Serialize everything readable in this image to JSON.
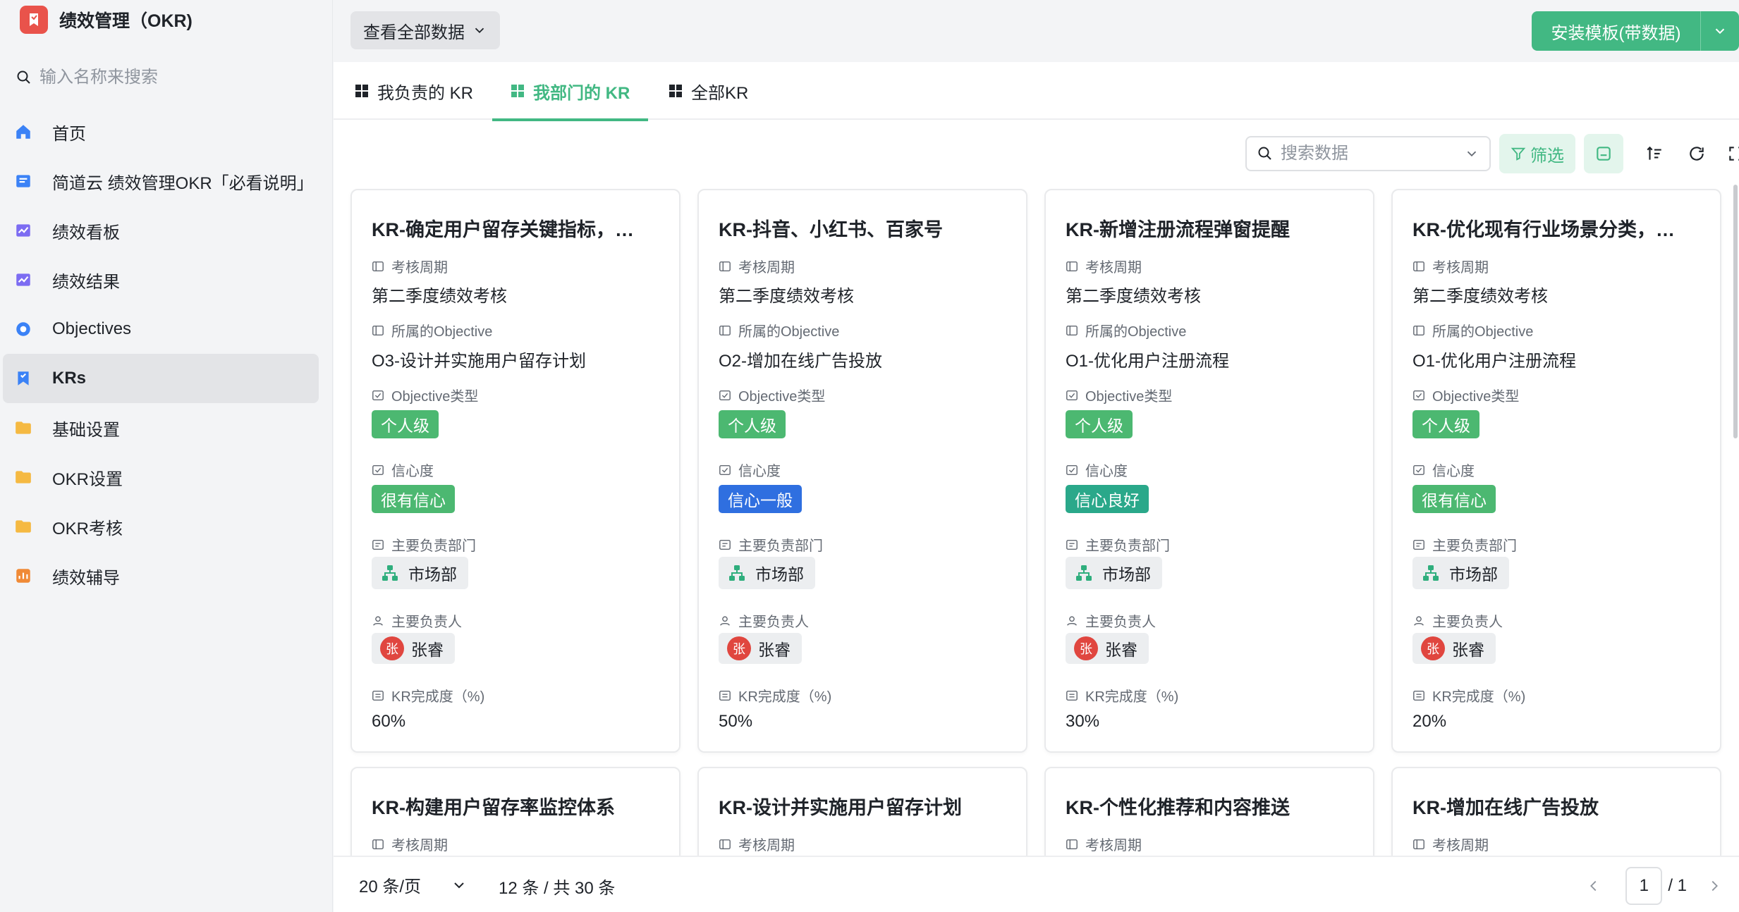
{
  "app": {
    "title": "绩效管理（OKR)"
  },
  "sidebar": {
    "search_placeholder": "输入名称来搜索",
    "items": [
      {
        "label": "首页",
        "icon": "home-icon"
      },
      {
        "label": "简道云 绩效管理OKR「必看说明」",
        "icon": "document-icon"
      },
      {
        "label": "绩效看板",
        "icon": "dashboard-chart-icon"
      },
      {
        "label": "绩效结果",
        "icon": "dashboard-chart-icon"
      },
      {
        "label": "Objectives",
        "icon": "circle-target-icon"
      },
      {
        "label": "KRs",
        "icon": "bookmark-icon",
        "active": true
      },
      {
        "label": "基础设置",
        "icon": "folder-icon"
      },
      {
        "label": "OKR设置",
        "icon": "folder-icon"
      },
      {
        "label": "OKR考核",
        "icon": "folder-icon"
      },
      {
        "label": "绩效辅导",
        "icon": "report-icon"
      }
    ]
  },
  "topbar": {
    "view_all_label": "查看全部数据",
    "install_label": "安装模板(带数据)"
  },
  "tabs": [
    {
      "label": "我负责的 KR"
    },
    {
      "label": "我部门的 KR",
      "active": true
    },
    {
      "label": "全部KR"
    }
  ],
  "toolbar": {
    "search_placeholder": "搜索数据",
    "filter_label": "筛选"
  },
  "field_labels": {
    "period": "考核周期",
    "objective": "所属的Objective",
    "objective_type": "Objective类型",
    "confidence": "信心度",
    "department": "主要负责部门",
    "owner": "主要负责人",
    "progress": "KR完成度（%)"
  },
  "cards": [
    {
      "title": "KR-确定用户留存关键指标，…",
      "period": "第二季度绩效考核",
      "objective": "O3-设计并实施用户留存计划",
      "objective_type": "个人级",
      "confidence": "很有信心",
      "confidence_color": "#4cb871",
      "department": "市场部",
      "owner_initial": "张",
      "owner": "张睿",
      "progress": "60%"
    },
    {
      "title": "KR-抖音、小红书、百家号",
      "period": "第二季度绩效考核",
      "objective": "O2-增加在线广告投放",
      "objective_type": "个人级",
      "confidence": "信心一般",
      "confidence_color": "#2f6fe0",
      "department": "市场部",
      "owner_initial": "张",
      "owner": "张睿",
      "progress": "50%"
    },
    {
      "title": "KR-新增注册流程弹窗提醒",
      "period": "第二季度绩效考核",
      "objective": "O1-优化用户注册流程",
      "objective_type": "个人级",
      "confidence": "信心良好",
      "confidence_color": "#2aa88a",
      "department": "市场部",
      "owner_initial": "张",
      "owner": "张睿",
      "progress": "30%"
    },
    {
      "title": "KR-优化现有行业场景分类，…",
      "period": "第二季度绩效考核",
      "objective": "O1-优化用户注册流程",
      "objective_type": "个人级",
      "confidence": "很有信心",
      "confidence_color": "#4cb871",
      "department": "市场部",
      "owner_initial": "张",
      "owner": "张睿",
      "progress": "20%"
    },
    {
      "title": "KR-构建用户留存率监控体系"
    },
    {
      "title": "KR-设计并实施用户留存计划"
    },
    {
      "title": "KR-个性化推荐和内容推送"
    },
    {
      "title": "KR-增加在线广告投放"
    }
  ],
  "footer": {
    "page_size": "20 条/页",
    "total": "12 条 / 共 30 条",
    "current_page": "1",
    "total_pages": "/ 1"
  },
  "colors": {
    "accent": "#42b883",
    "tag_green": "#4cb871",
    "logo_red": "#e9534b"
  }
}
